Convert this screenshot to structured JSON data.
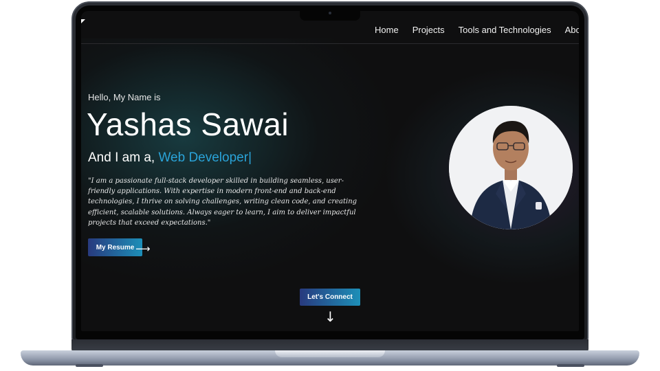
{
  "nav": {
    "items": [
      "Home",
      "Projects",
      "Tools and Technologies",
      "Abo"
    ]
  },
  "hero": {
    "greeting": "Hello, My Name is",
    "name": "Yashas Sawai",
    "role_prefix": "And I am a, ",
    "role_highlight": "Web Developer",
    "cursor": "|",
    "quote": "\"I am a passionate full-stack developer skilled in building seamless, user-friendly applications. With expertise in modern front-end and back-end technologies, I thrive on solving challenges, writing clean code, and creating efficient, scalable solutions. Always eager to learn, I aim to deliver impactful projects that exceed expectations.\"",
    "resume_label": "My Resume",
    "resume_arrow": "⟶"
  },
  "connect": {
    "label": "Let's Connect",
    "arrow": "↓"
  },
  "colors": {
    "accent": "#2aa3d8",
    "button_start": "#283a7e",
    "button_end": "#1d8fb8",
    "background": "#0f0f10"
  }
}
